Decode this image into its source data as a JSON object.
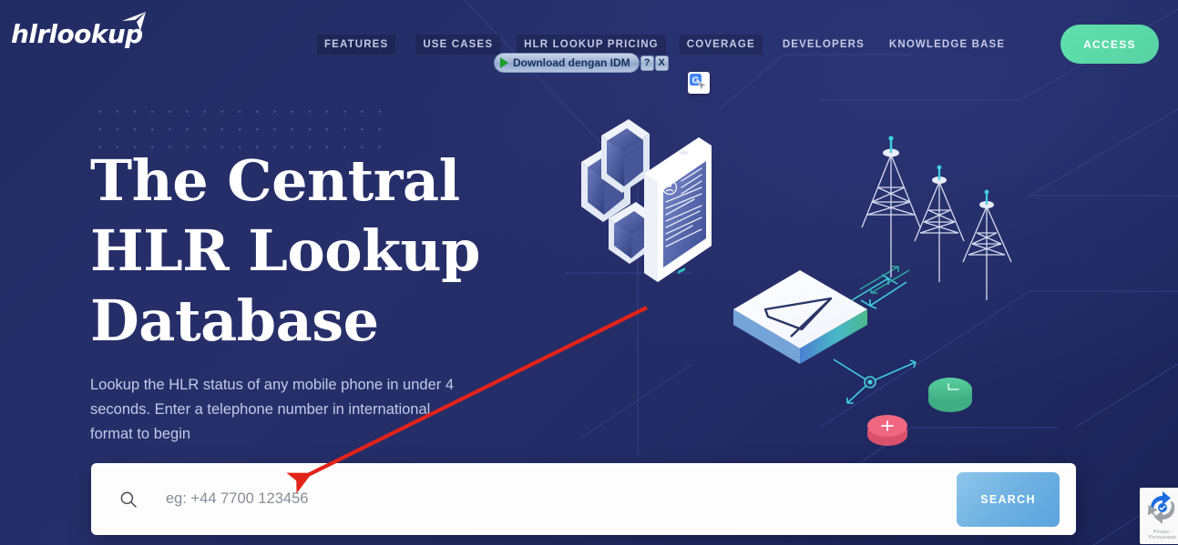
{
  "brand": {
    "logo_text": "hlrlookup",
    "logo_icon": "paper-plane-icon"
  },
  "nav": {
    "items": [
      {
        "label": "FEATURES",
        "highlighted": true
      },
      {
        "label": "USE CASES",
        "highlighted": true
      },
      {
        "label": "HLR LOOKUP PRICING",
        "highlighted": true
      },
      {
        "label": "COVERAGE",
        "highlighted": true
      },
      {
        "label": "DEVELOPERS",
        "highlighted": false
      },
      {
        "label": "KNOWLEDGE BASE",
        "highlighted": false
      }
    ],
    "access_label": "ACCESS"
  },
  "idm_popup": {
    "button_label": "Download dengan IDM",
    "help_label": "?",
    "close_label": "X",
    "play_icon": "play-triangle-icon",
    "translate_icon": "google-translate-icon"
  },
  "hero": {
    "title_line1": "The Central",
    "title_line2": "HLR Lookup",
    "title_line3": "Database",
    "subtitle": "Lookup the HLR status of any mobile phone in under 4 seconds. Enter a telephone number in international format to begin"
  },
  "search": {
    "icon": "magnifier-icon",
    "placeholder": "eg: +44 7700 123456",
    "value": "",
    "button_label": "SEARCH"
  },
  "recaptcha": {
    "icon": "recaptcha-icon",
    "label": "Privasi - Persyaratan"
  },
  "illustration": {
    "items": [
      "isometric-tablet-contact-card",
      "isometric-phone-small-1",
      "isometric-phone-small-2",
      "isometric-phone-small-3",
      "isometric-message-card",
      "cell-tower-1",
      "cell-tower-2",
      "cell-tower-3",
      "green-clock-disc",
      "pink-plus-disc"
    ]
  },
  "annotation": {
    "arrow": "red-arrow-pointing-to-search-input",
    "color": "#e2231a"
  },
  "colors": {
    "background_dark": "#222c63",
    "background_mid": "#272f6b",
    "accent_mint": "#5fe0ae",
    "accent_blue": "#6fb2e2",
    "accent_pink": "#f0657f",
    "accent_cyan": "#3fd0e0",
    "text_light": "#c2cae6",
    "white": "#ffffff",
    "annotation_red": "#e2231a"
  }
}
